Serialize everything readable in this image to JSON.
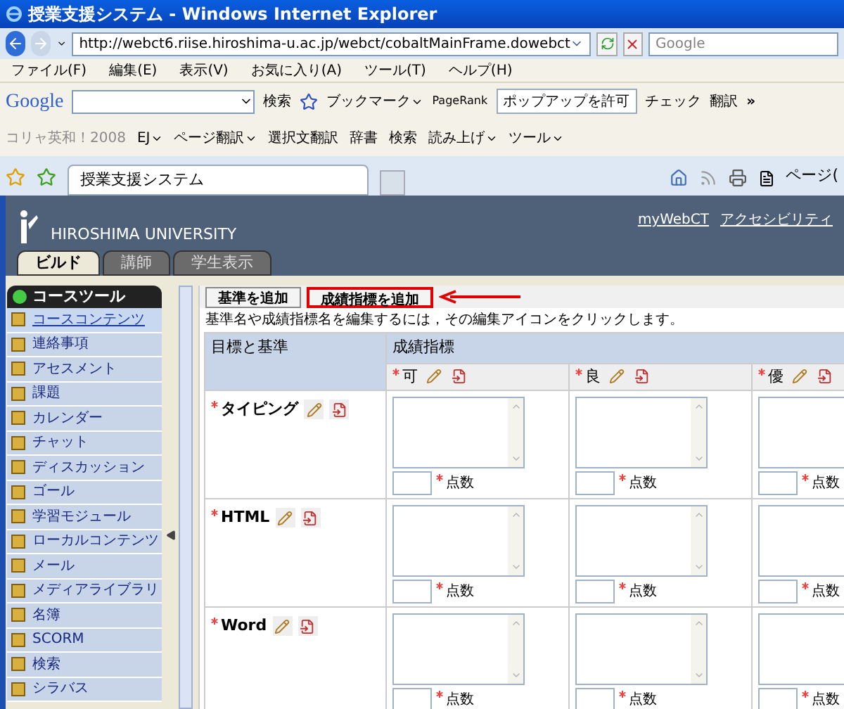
{
  "window": {
    "title": "授業支援システム - Windows Internet Explorer"
  },
  "address": {
    "url": "http://webct6.riise.hiroshima-u.ac.jp/webct/cobaltMainFrame.dowebct",
    "search_placeholder": "Google"
  },
  "menu": [
    "ファイル(F)",
    "編集(E)",
    "表示(V)",
    "お気に入り(A)",
    "ツール(T)",
    "ヘルプ(H)"
  ],
  "google_toolbar": {
    "logo": "Google",
    "search_button": "検索",
    "bookmarks": "ブックマーク",
    "pagerank": "PageRank",
    "popup": "ポップアップを許可",
    "check": "チェック",
    "translate": "翻訳",
    "more": "»"
  },
  "dict_toolbar": {
    "label": "コリャ英和！2008",
    "items": [
      {
        "kind": "menu",
        "label": "EJ"
      },
      {
        "kind": "menu",
        "label": "ページ翻訳"
      },
      {
        "kind": "button",
        "label": "選択文翻訳"
      },
      {
        "kind": "button",
        "label": "辞書"
      },
      {
        "kind": "button",
        "label": "検索"
      },
      {
        "kind": "menu",
        "label": "読み上げ"
      },
      {
        "kind": "menu",
        "label": "ツール"
      }
    ]
  },
  "browser_tab": {
    "label": "授業支援システム"
  },
  "command_bar": {
    "page": "ページ("
  },
  "header": {
    "university": "HIROSHIMA UNIVERSITY",
    "links": [
      "myWebCT",
      "アクセシビリティ"
    ]
  },
  "tabs": [
    {
      "label": "ビルド",
      "selected": true
    },
    {
      "label": "講師",
      "selected": false
    },
    {
      "label": "学生表示",
      "selected": false
    }
  ],
  "sidebar": {
    "title": "コースツール",
    "items": [
      {
        "label": "コースコンテンツ",
        "selected": true
      },
      {
        "label": "連絡事項",
        "selected": false
      },
      {
        "label": "アセスメント",
        "selected": false
      },
      {
        "label": "課題",
        "selected": false
      },
      {
        "label": "カレンダー",
        "selected": false
      },
      {
        "label": "チャット",
        "selected": false
      },
      {
        "label": "ディスカッション",
        "selected": false
      },
      {
        "label": "ゴール",
        "selected": false
      },
      {
        "label": "学習モジュール",
        "selected": false
      },
      {
        "label": "ローカルコンテンツ",
        "selected": false
      },
      {
        "label": "メール",
        "selected": false
      },
      {
        "label": "メディアライブラリ",
        "selected": false
      },
      {
        "label": "名簿",
        "selected": false
      },
      {
        "label": "SCORM",
        "selected": false
      },
      {
        "label": "検索",
        "selected": false
      },
      {
        "label": "シラバス",
        "selected": false
      }
    ]
  },
  "buttons": [
    {
      "label": "基準を追加",
      "highlighted": false
    },
    {
      "label": "成績指標を追加",
      "highlighted": true
    }
  ],
  "instruction": "基準名や成績指標名を編集するには，その編集アイコンをクリックします。",
  "table": {
    "criteria_header": "目標と基準",
    "levels_header": "成績指標",
    "levels": [
      "可",
      "良",
      "優"
    ],
    "rows": [
      {
        "label": "タイピング",
        "cells": [
          {
            "score_label": "点数"
          },
          {
            "score_label": "点数"
          },
          {
            "score_label": "点数"
          }
        ]
      },
      {
        "label": "HTML",
        "cells": [
          {
            "score_label": "点数"
          },
          {
            "score_label": "点数"
          },
          {
            "score_label": "点数"
          }
        ]
      },
      {
        "label": "Word",
        "cells": [
          {
            "score_label": "点数"
          },
          {
            "score_label": "点数"
          },
          {
            "score_label": "点数"
          }
        ]
      }
    ]
  }
}
